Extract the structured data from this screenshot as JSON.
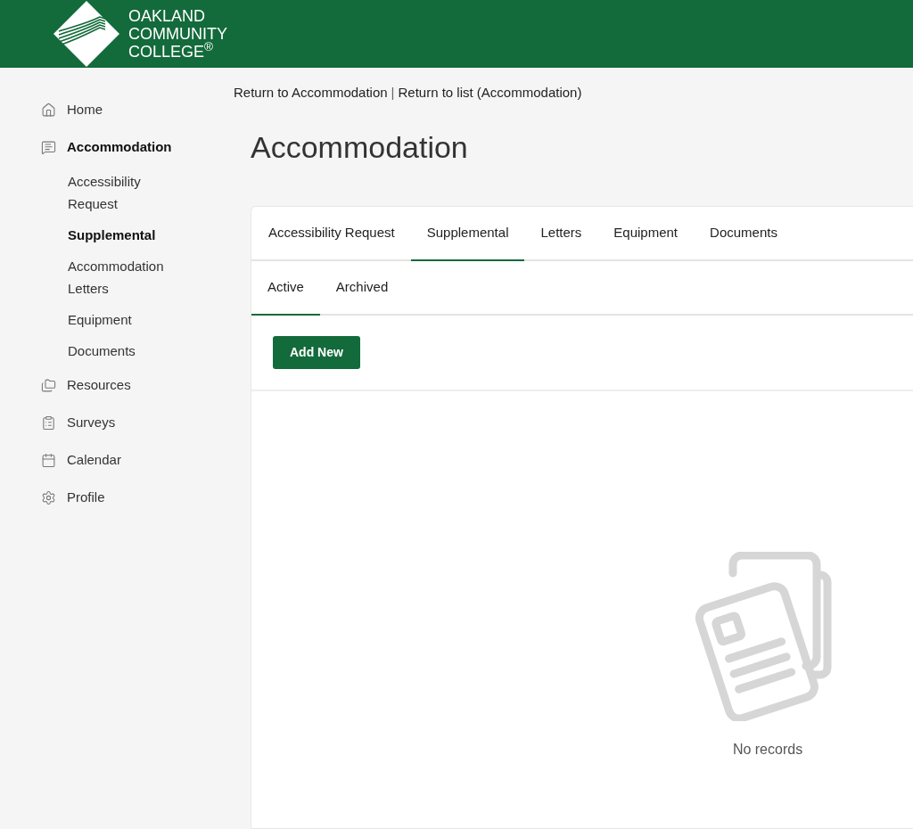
{
  "header": {
    "logo_lines": [
      "OAKLAND",
      "COMMUNITY",
      "COLLEGE$^{®}$"
    ]
  },
  "sidebar": {
    "items": [
      {
        "kind": "main",
        "label": "Home",
        "selected": false
      },
      {
        "kind": "main",
        "label": "Accommodation",
        "selected": true
      },
      {
        "kind": "sub",
        "label": "Accessibility Request",
        "selected": false
      },
      {
        "kind": "sub",
        "label": "Supplemental",
        "selected": true
      },
      {
        "kind": "sub",
        "label": "Accommodation Letters",
        "selected": false
      },
      {
        "kind": "sub",
        "label": "Equipment",
        "selected": false
      },
      {
        "kind": "sub",
        "label": "Documents",
        "selected": false
      },
      {
        "kind": "main",
        "label": "Resources",
        "selected": false
      },
      {
        "kind": "main",
        "label": "Surveys",
        "selected": false
      },
      {
        "kind": "main",
        "label": "Calendar",
        "selected": false
      },
      {
        "kind": "main",
        "label": "Profile",
        "selected": false
      }
    ]
  },
  "breadcrumb": {
    "links": [
      "Return to Accommodation",
      "Return to list (Accommodation)"
    ],
    "separator": "|"
  },
  "page_title": "Accommodation",
  "tabs": [
    {
      "label": "Accessibility Request",
      "selected": false
    },
    {
      "label": "Supplemental",
      "selected": true
    },
    {
      "label": "Letters",
      "selected": false
    },
    {
      "label": "Equipment",
      "selected": false
    },
    {
      "label": "Documents",
      "selected": false
    }
  ],
  "subtabs": [
    {
      "label": "Active",
      "selected": true
    },
    {
      "label": "Archived",
      "selected": false
    }
  ],
  "add_button": "Add New",
  "empty_state": {
    "message": "No records"
  }
}
